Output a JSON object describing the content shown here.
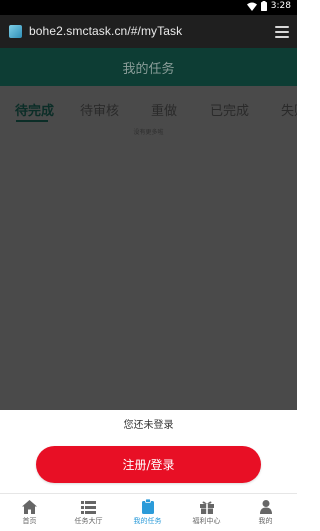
{
  "status_bar": {
    "time": "3:28"
  },
  "browser": {
    "url": "bohe2.smctask.cn/#/myTask"
  },
  "header": {
    "title": "我的任务"
  },
  "tabs": [
    {
      "label": "待完成",
      "active": true
    },
    {
      "label": "待审核",
      "active": false
    },
    {
      "label": "重做",
      "active": false
    },
    {
      "label": "已完成",
      "active": false
    },
    {
      "label": "失败",
      "active": false
    }
  ],
  "list": {
    "empty_text": "没有更多啦"
  },
  "login": {
    "prompt": "您还未登录",
    "button_label": "注册/登录",
    "button_color": "#e80f25"
  },
  "bottom_nav": [
    {
      "label": "首页",
      "icon": "home-icon",
      "active": false
    },
    {
      "label": "任务大厅",
      "icon": "list-icon",
      "active": false
    },
    {
      "label": "我的任务",
      "icon": "clipboard-icon",
      "active": true
    },
    {
      "label": "福利中心",
      "icon": "gift-icon",
      "active": false
    },
    {
      "label": "我的",
      "icon": "user-icon",
      "active": false
    }
  ],
  "colors": {
    "header_bg": "#0d3d34",
    "overlay": "#4a4a4a",
    "nav_active": "#2b9bd9"
  }
}
